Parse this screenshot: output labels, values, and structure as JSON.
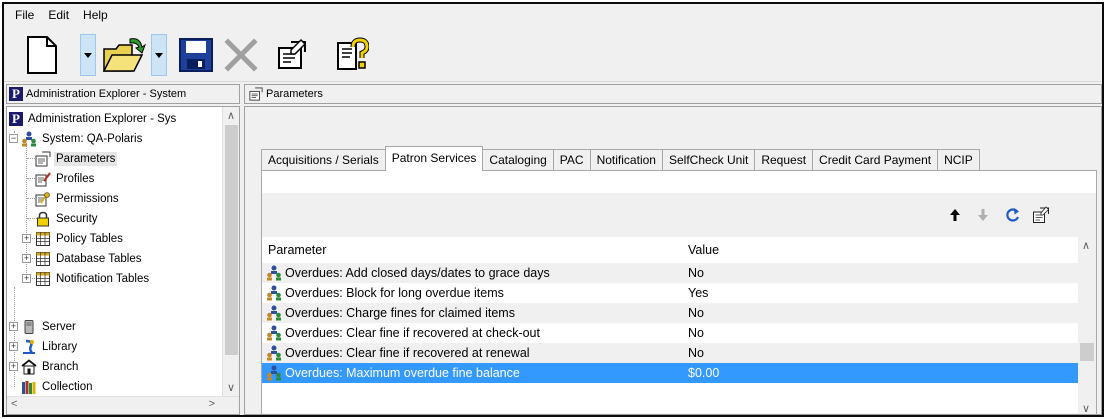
{
  "menu": [
    "File",
    "Edit",
    "Help"
  ],
  "toolbar": {
    "icons": [
      "new-document-icon",
      "open-folder-icon",
      "save-icon",
      "delete-icon",
      "properties-icon",
      "help-icon"
    ]
  },
  "left_pane": {
    "header": "Administration Explorer - System",
    "tree": {
      "root": "Administration Explorer - Sys",
      "system": "System: QA-Polaris",
      "items": [
        "Parameters",
        "Profiles",
        "Permissions",
        "Security",
        "Policy Tables",
        "Database Tables",
        "Notification Tables"
      ],
      "top_level": [
        "Server",
        "Library",
        "Branch",
        "Collection"
      ]
    }
  },
  "right_pane": {
    "header": "Parameters",
    "tabs": [
      "Acquisitions / Serials",
      "Patron Services",
      "Cataloging",
      "PAC",
      "Notification",
      "SelfCheck Unit",
      "Request",
      "Credit Card Payment",
      "NCIP"
    ],
    "active_tab": "Patron Services",
    "columns": {
      "parameter": "Parameter",
      "value": "Value"
    },
    "rows": [
      {
        "parameter": "Overdues: Add closed days/dates to grace days",
        "value": "No"
      },
      {
        "parameter": "Overdues: Block for long overdue items",
        "value": "Yes"
      },
      {
        "parameter": "Overdues: Charge fines for claimed items",
        "value": "No"
      },
      {
        "parameter": "Overdues: Clear fine if recovered at check-out",
        "value": "No"
      },
      {
        "parameter": "Overdues: Clear fine if recovered at renewal",
        "value": "No"
      },
      {
        "parameter": "Overdues: Maximum overdue fine balance",
        "value": "$0.00"
      }
    ],
    "selected_row": 5,
    "colors": {
      "selection": "#3399ff",
      "alt_row": "#f0f0f0"
    }
  }
}
